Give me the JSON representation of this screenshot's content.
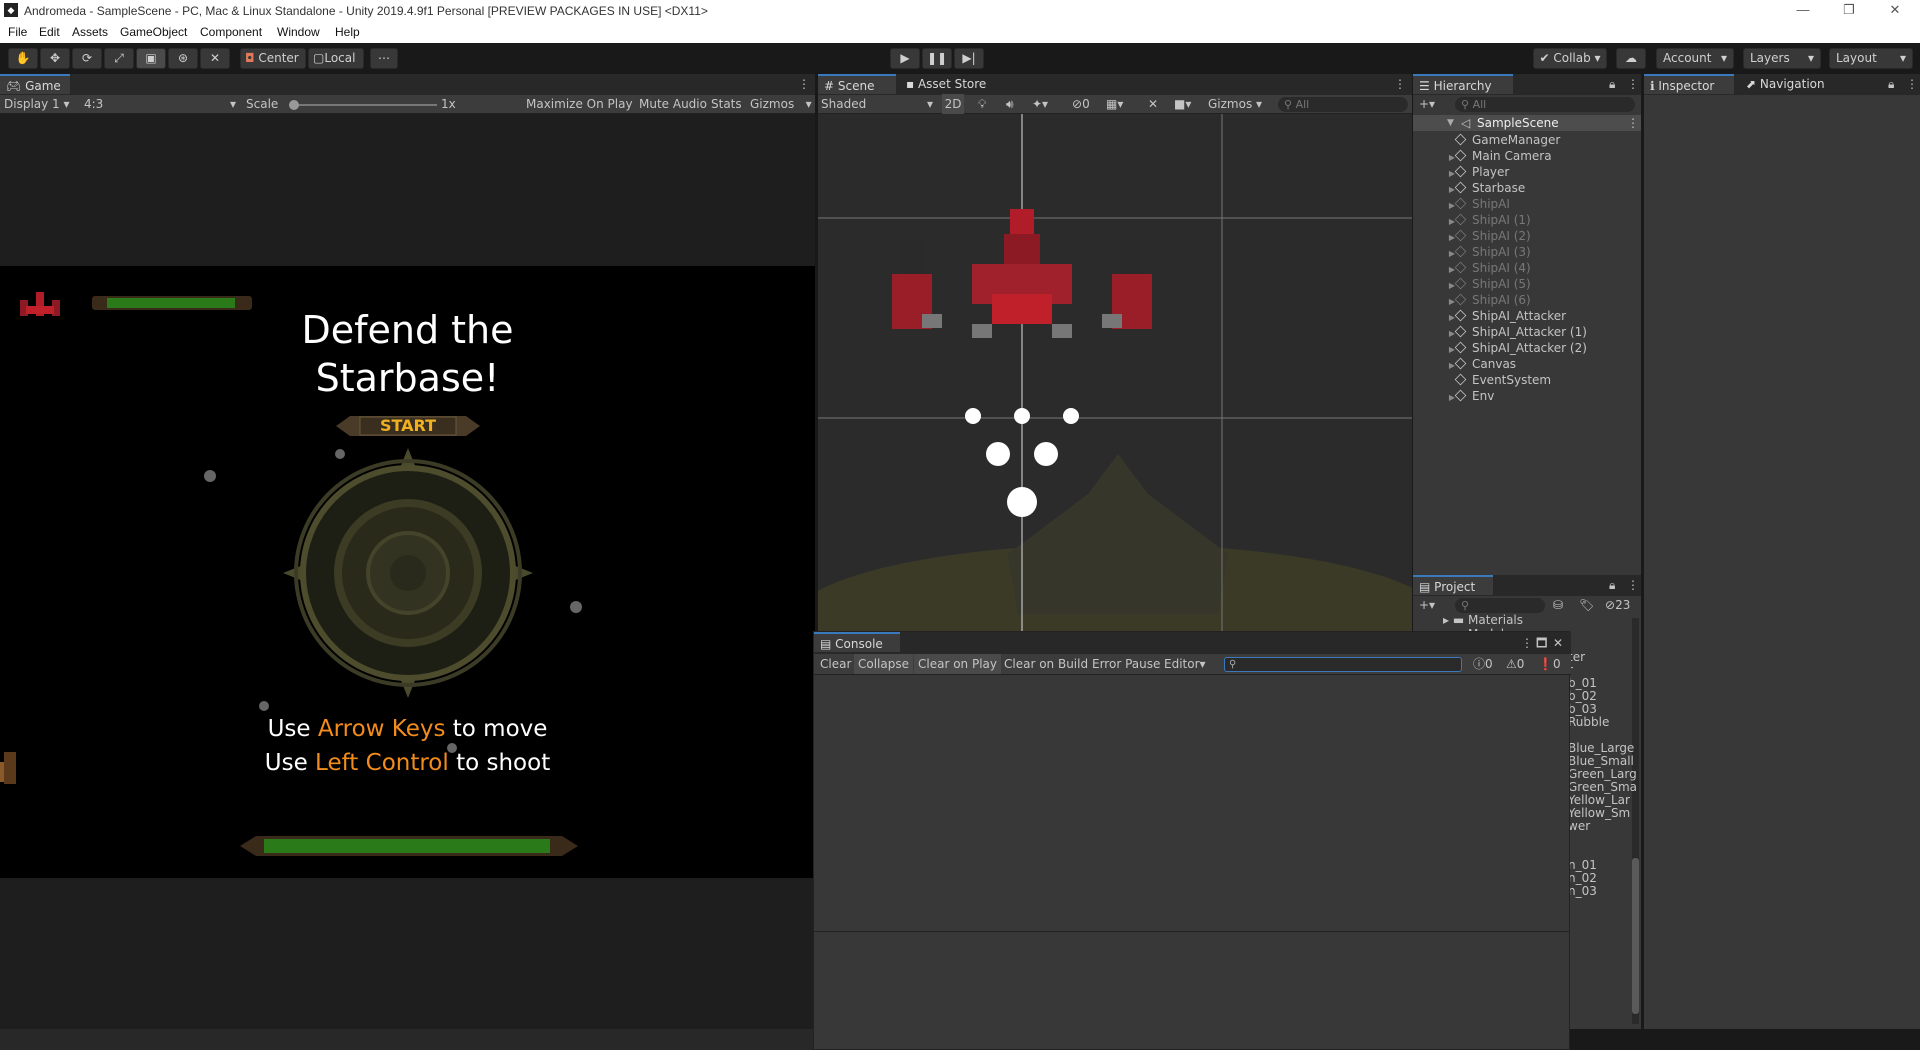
{
  "titlebar": {
    "title": "Andromeda - SampleScene - PC, Mac & Linux Standalone - Unity 2019.4.9f1 Personal [PREVIEW PACKAGES IN USE] <DX11>",
    "minimize": "—",
    "restore": "❐",
    "close": "✕"
  },
  "menu": [
    "File",
    "Edit",
    "Assets",
    "GameObject",
    "Component",
    "Window",
    "Help"
  ],
  "toolbar": {
    "center": "Center",
    "local": "Local",
    "collab": "Collab ▾",
    "account": "Account",
    "layers": "Layers",
    "layout": "Layout"
  },
  "game": {
    "tab": "Game",
    "display": "Display 1",
    "aspect": "4:3",
    "scale_label": "Scale",
    "scale_value": "1x",
    "scale_slider": 0,
    "maximize": "Maximize On Play",
    "mute": "Mute Audio",
    "stats": "Stats",
    "gizmos": "Gizmos",
    "title_line1": "Defend the",
    "title_line2": "Starbase!",
    "start": "START",
    "instr1_pre": "Use ",
    "instr1_key": "Arrow Keys",
    "instr1_post": " to move",
    "instr2_pre": "Use ",
    "instr2_key": "Left Control",
    "instr2_post": " to shoot"
  },
  "scene": {
    "tab": "Scene",
    "asset_store": "Asset Store",
    "shading": "Shaded",
    "mode2d": "2D",
    "hidden_count": "0",
    "gizmos": "Gizmos",
    "search_placeholder": "All"
  },
  "hierarchy": {
    "tab": "Hierarchy",
    "search_placeholder": "All",
    "scene": "SampleScene",
    "items": [
      {
        "name": "GameManager",
        "arrow": false,
        "dim": false
      },
      {
        "name": "Main Camera",
        "arrow": true,
        "dim": false
      },
      {
        "name": "Player",
        "arrow": true,
        "dim": false
      },
      {
        "name": "Starbase",
        "arrow": true,
        "dim": false
      },
      {
        "name": "ShipAI",
        "arrow": true,
        "dim": true
      },
      {
        "name": "ShipAI (1)",
        "arrow": true,
        "dim": true
      },
      {
        "name": "ShipAI (2)",
        "arrow": true,
        "dim": true
      },
      {
        "name": "ShipAI (3)",
        "arrow": true,
        "dim": true
      },
      {
        "name": "ShipAI (4)",
        "arrow": true,
        "dim": true
      },
      {
        "name": "ShipAI (5)",
        "arrow": true,
        "dim": true
      },
      {
        "name": "ShipAI (6)",
        "arrow": true,
        "dim": true
      },
      {
        "name": "ShipAI_Attacker",
        "arrow": true,
        "dim": false
      },
      {
        "name": "ShipAI_Attacker (1)",
        "arrow": true,
        "dim": false
      },
      {
        "name": "ShipAI_Attacker (2)",
        "arrow": true,
        "dim": false
      },
      {
        "name": "Canvas",
        "arrow": true,
        "dim": false
      },
      {
        "name": "EventSystem",
        "arrow": false,
        "dim": false
      },
      {
        "name": "Env",
        "arrow": true,
        "dim": false
      }
    ]
  },
  "inspector": {
    "tab": "Inspector",
    "navigation": "Navigation"
  },
  "project": {
    "tab": "Project",
    "hidden_count": "23",
    "folders": [
      "Materials",
      "Models"
    ],
    "items": [
      "ter",
      "r",
      "b_01",
      "b_02",
      "b_03",
      "Rubble",
      "",
      "Blue_Large",
      "Blue_Small",
      "Green_Larg",
      "Green_Sma",
      "Yellow_Lar",
      "Yellow_Sm",
      "wer",
      "",
      "",
      "n_01",
      "n_02",
      "n_03"
    ]
  },
  "console": {
    "tab": "Console",
    "clear": "Clear",
    "collapse": "Collapse",
    "clear_on_play": "Clear on Play",
    "clear_on_build": "Clear on Build",
    "error_pause": "Error Pause",
    "editor": "Editor",
    "log_count": "0",
    "warn_count": "0",
    "error_count": "0"
  },
  "colors": {
    "accent_blue": "#3a79bb",
    "orange_text": "#f28c1c",
    "start_text": "#f0b020",
    "enemy_red": "#c0202a"
  }
}
